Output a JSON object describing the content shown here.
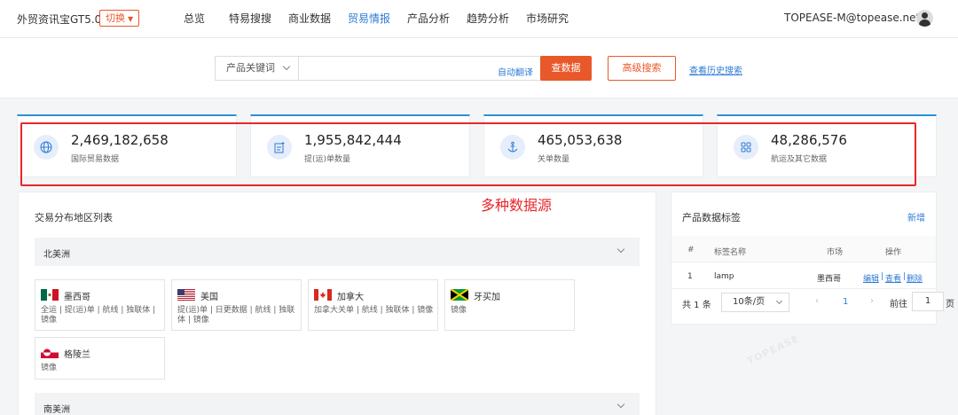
{
  "header": {
    "brand": "外贸资讯宝GT5.0",
    "switch_label": "切换",
    "nav": [
      {
        "label": "总览",
        "active": false
      },
      {
        "label": "特易搜搜",
        "active": false
      },
      {
        "label": "商业数据",
        "active": false
      },
      {
        "label": "贸易情报",
        "active": true
      },
      {
        "label": "产品分析",
        "active": false
      },
      {
        "label": "趋势分析",
        "active": false
      },
      {
        "label": "市场研究",
        "active": false
      }
    ],
    "user_email": "TOPEASE-M@topease.net"
  },
  "search": {
    "type_label": "产品关键词",
    "query": "",
    "auto_translate": "自动翻译",
    "search_button": "查数据",
    "advanced_button": "高级搜索",
    "history_link": "查看历史搜索"
  },
  "stats": [
    {
      "icon": "globe-icon",
      "value": "2,469,182,658",
      "label": "国际贸易数据"
    },
    {
      "icon": "bill-of-lading-icon",
      "value": "1,955,842,444",
      "label": "提(运)单数量"
    },
    {
      "icon": "anchor-icon",
      "value": "465,053,638",
      "label": "关单数量"
    },
    {
      "icon": "grid-icon",
      "value": "48,286,576",
      "label": "航运及其它数据"
    }
  ],
  "annotation": "多种数据源",
  "distribution": {
    "title": "交易分布地区列表",
    "regions": [
      {
        "name": "北美洲",
        "countries": [
          {
            "name": "墨西哥",
            "flag": "mexico-flag-icon",
            "links": "全运 | 提(运)单 | 航线 | 独联体 | 镜像"
          },
          {
            "name": "美国",
            "flag": "usa-flag-icon",
            "links": "提(运)单 | 日更数据 | 航线 | 独联体 | 镜像"
          },
          {
            "name": "加拿大",
            "flag": "canada-flag-icon",
            "links": "加拿大关单 | 航线 | 独联体 | 镜像"
          },
          {
            "name": "牙买加",
            "flag": "jamaica-flag-icon",
            "links": "镜像"
          },
          {
            "name": "格陵兰",
            "flag": "greenland-flag-icon",
            "links": "镜像"
          }
        ]
      },
      {
        "name": "南美洲",
        "countries": []
      }
    ]
  },
  "tags_panel": {
    "title": "产品数据标签",
    "add_label": "新增",
    "columns": [
      "#",
      "标签名称",
      "市场",
      "操作"
    ],
    "rows": [
      {
        "index": "1",
        "name": "lamp",
        "market": "墨西哥",
        "actions": [
          "编辑",
          "查看",
          "删除"
        ]
      }
    ],
    "pager": {
      "total": "共 1 条",
      "page_size": "10条/页",
      "current_page": "1",
      "goto_label": "前往",
      "goto_value": "1",
      "unit": "页"
    }
  },
  "watermark": "TOPEASE"
}
